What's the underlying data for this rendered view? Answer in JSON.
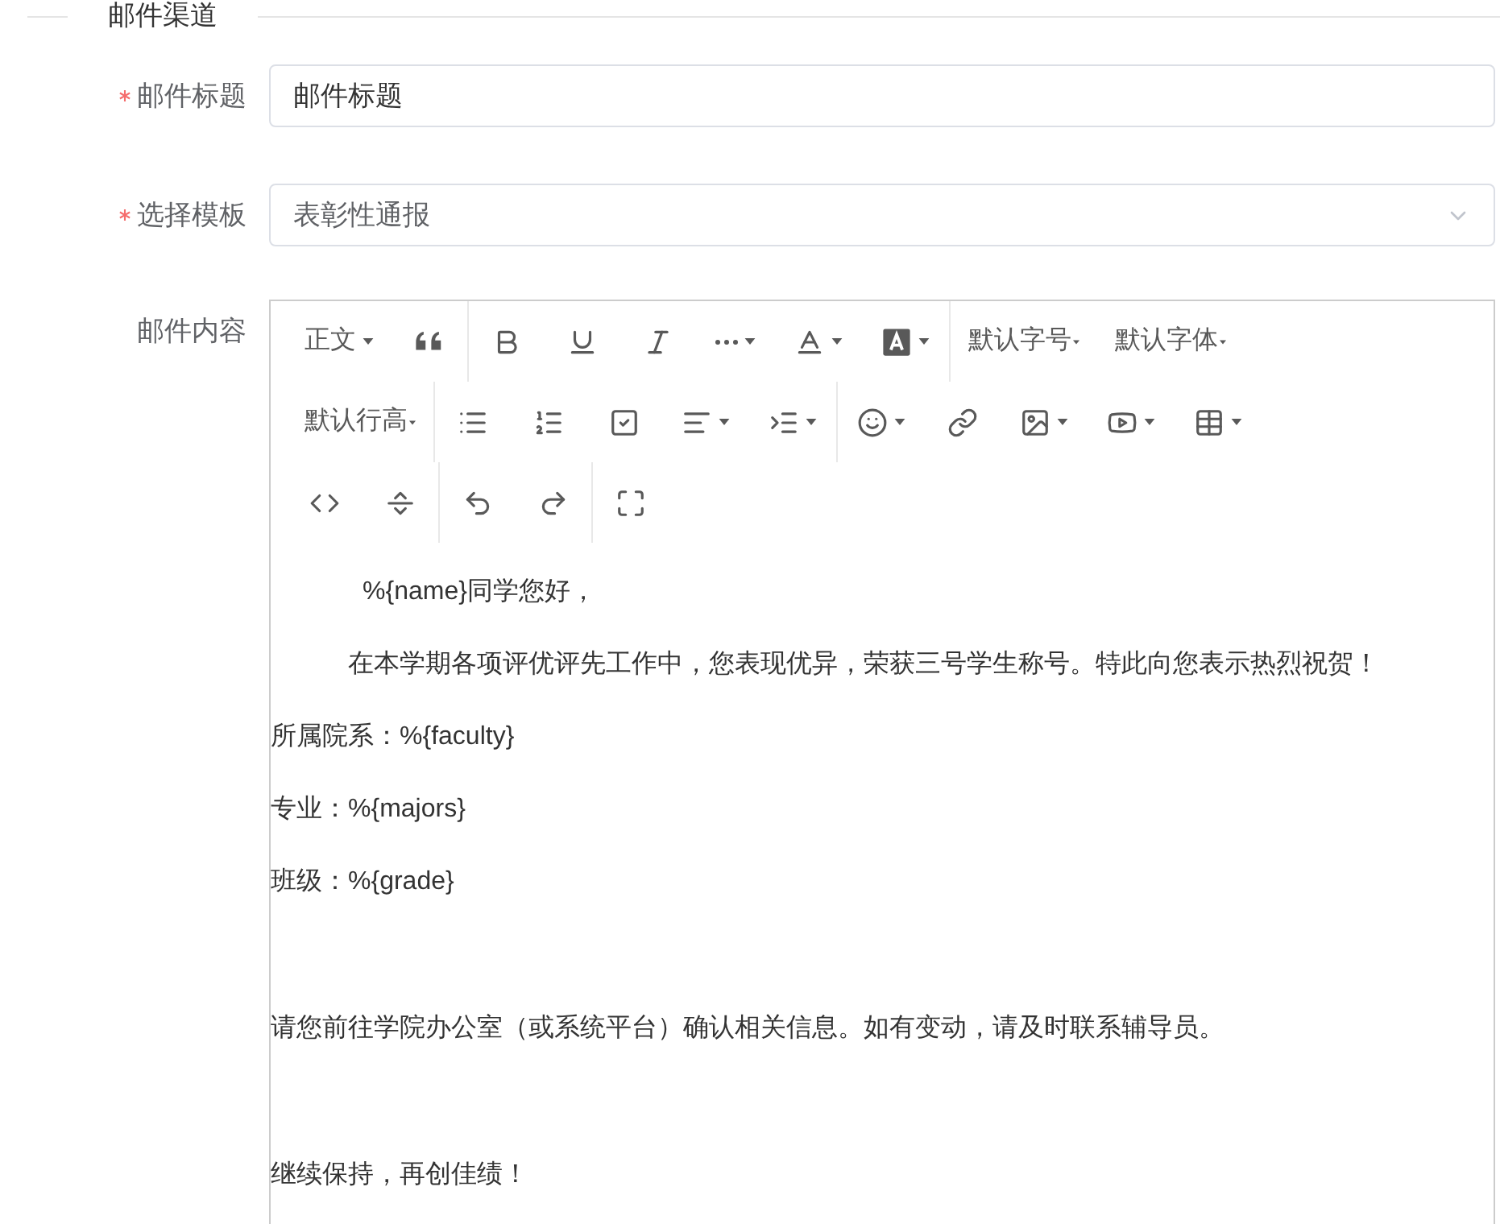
{
  "section": {
    "title": "邮件渠道"
  },
  "fields": [
    {
      "label": "邮件标题",
      "required": true,
      "kind": "input",
      "value": "邮件标题"
    },
    {
      "label": "选择模板",
      "required": true,
      "kind": "select",
      "value": "表彰性通报"
    }
  ],
  "editor": {
    "label": "邮件内容",
    "toolbar": [
      [
        [
          {
            "kind": "text",
            "label": "正文",
            "dropdown": true
          },
          {
            "kind": "icon",
            "dropdown": false
          }
        ],
        [
          {
            "kind": "icon",
            "dropdown": false
          },
          {
            "kind": "icon",
            "dropdown": false
          },
          {
            "kind": "icon",
            "dropdown": false
          },
          {
            "kind": "icon",
            "dropdown": true
          },
          {
            "kind": "icon",
            "dropdown": true
          },
          {
            "kind": "icon",
            "dropdown": true
          }
        ],
        [
          {
            "kind": "text",
            "label": "默认字号",
            "dropdown": true
          },
          {
            "kind": "text",
            "label": "默认字体",
            "dropdown": true
          }
        ]
      ],
      [
        [
          {
            "kind": "text",
            "label": "默认行高",
            "dropdown": true
          }
        ],
        [
          {
            "kind": "icon",
            "dropdown": false
          },
          {
            "kind": "icon",
            "dropdown": false
          },
          {
            "kind": "icon",
            "dropdown": false
          },
          {
            "kind": "icon",
            "dropdown": true
          },
          {
            "kind": "icon",
            "dropdown": true
          }
        ],
        [
          {
            "kind": "icon",
            "dropdown": true
          },
          {
            "kind": "icon",
            "dropdown": false
          },
          {
            "kind": "icon",
            "dropdown": true
          },
          {
            "kind": "icon",
            "dropdown": true
          },
          {
            "kind": "icon",
            "dropdown": true
          }
        ]
      ],
      [
        [
          {
            "kind": "icon",
            "dropdown": false
          },
          {
            "kind": "icon",
            "dropdown": false
          }
        ],
        [
          {
            "kind": "icon",
            "dropdown": false
          },
          {
            "kind": "icon",
            "dropdown": false
          }
        ],
        [
          {
            "kind": "icon",
            "dropdown": false
          }
        ]
      ]
    ],
    "paragraphs": [
      {
        "text": "%{name}同学您好，",
        "kind": "indent-wide"
      },
      {
        "text": "在本学期各项评优评先工作中，您表现优异，荣获三号学生称号。特此向您表示热烈祝贺！",
        "kind": "indent"
      },
      {
        "text": "所属院系：%{faculty}",
        "kind": "plain"
      },
      {
        "text": "专业：%{majors}",
        "kind": "plain"
      },
      {
        "text": "班级：%{grade}",
        "kind": "plain"
      },
      {
        "text": "请您前往学院办公室（或系统平台）确认相关信息。如有变动，请及时联系辅导员。",
        "kind": "spaced"
      },
      {
        "text": "继续保持，再创佳绩！",
        "kind": "spaced"
      }
    ]
  }
}
